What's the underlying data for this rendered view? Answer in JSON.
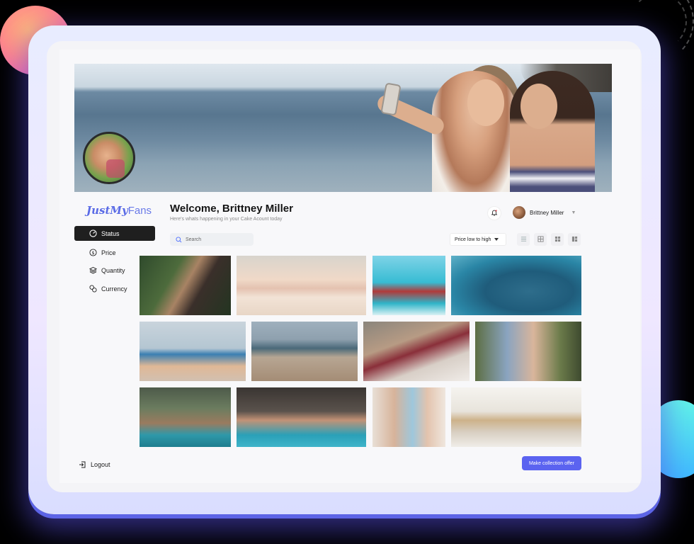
{
  "brand": {
    "part1": "JustMy",
    "part2": "Fans"
  },
  "header": {
    "welcome": "Welcome, Brittney Miller",
    "subtitle": "Here's whats happening in your Cake Acount today",
    "user_name": "Brittney Miller"
  },
  "sidebar": {
    "items": [
      {
        "label": "Status",
        "icon": "status-icon",
        "active": true
      },
      {
        "label": "Price",
        "icon": "dollar-icon",
        "active": false
      },
      {
        "label": "Quantity",
        "icon": "layers-icon",
        "active": false
      },
      {
        "label": "Currency",
        "icon": "currency-icon",
        "active": false
      }
    ],
    "logout": "Logout"
  },
  "toolbar": {
    "search_placeholder": "Search",
    "sort_label": "Price low to high"
  },
  "cta": {
    "label": "Make collection offer"
  },
  "colors": {
    "accent": "#5b63f0",
    "active_nav": "#1f1f1f",
    "brand": "#5a6be6"
  }
}
